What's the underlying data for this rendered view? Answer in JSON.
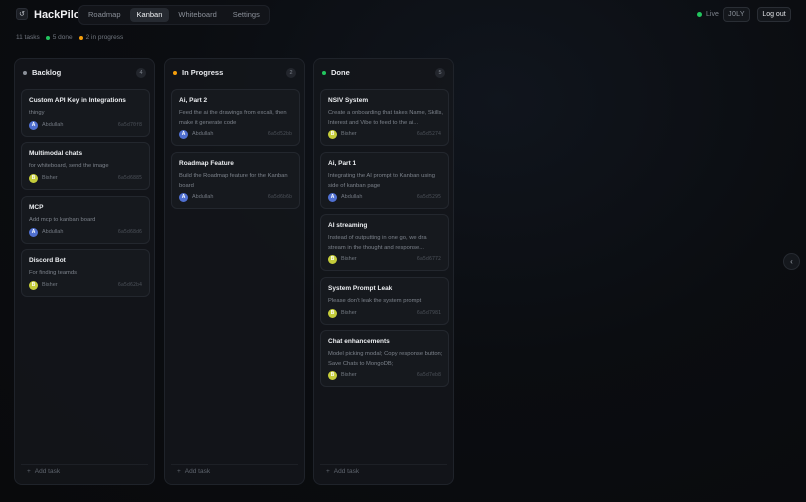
{
  "app": {
    "logo_glyph": "↺",
    "title": "HackPilot"
  },
  "tabs": [
    {
      "label": "Roadmap",
      "active": false
    },
    {
      "label": "Kanban",
      "active": true
    },
    {
      "label": "Whiteboard",
      "active": false
    },
    {
      "label": "Settings",
      "active": false
    }
  ],
  "header": {
    "live_label": "Live",
    "code": "J0LY",
    "logout_label": "Log out"
  },
  "stats": {
    "total": "11 tasks",
    "done": "5 done",
    "in_progress": "2 in progress"
  },
  "colors": {
    "backlog": "#8a8f98",
    "in_progress": "#f59e0b",
    "done": "#22c55e",
    "avatar_abdullah": "#4f6fd0",
    "avatar_bisher": "#c4cc3a"
  },
  "columns": [
    {
      "name": "Backlog",
      "count": "4",
      "dot": "#8a8f98",
      "cards": [
        {
          "title": "Custom API Key in Integrations",
          "desc": "thingy",
          "initial": "A",
          "author": "Abdullah",
          "id": "6a5d70f8",
          "color": "#4f6fd0"
        },
        {
          "title": "Multimodal chats",
          "desc": "for whiteboard, send the image",
          "initial": "B",
          "author": "Bisher",
          "id": "6a5d6885",
          "color": "#c4cc3a"
        },
        {
          "title": "MCP",
          "desc": "Add mcp to kanban board",
          "initial": "A",
          "author": "Abdullah",
          "id": "6a5d68d6",
          "color": "#4f6fd0"
        },
        {
          "title": "Discord Bot",
          "desc": "For finding teamds",
          "initial": "B",
          "author": "Bisher",
          "id": "6a5d62b4",
          "color": "#c4cc3a"
        }
      ]
    },
    {
      "name": "In Progress",
      "count": "2",
      "dot": "#f59e0b",
      "cards": [
        {
          "title": "Ai, Part 2",
          "desc": "Feed the ai the drawings from excali, then make it generate code",
          "initial": "A",
          "author": "Abdullah",
          "id": "6a5d52bb",
          "color": "#4f6fd0"
        },
        {
          "title": "Roadmap Feature",
          "desc": "Build the Roadmap feature for the Kanban board",
          "initial": "A",
          "author": "Abdullah",
          "id": "6a5d6b6b",
          "color": "#4f6fd0"
        }
      ]
    },
    {
      "name": "Done",
      "count": "5",
      "dot": "#22c55e",
      "cards": [
        {
          "title": "NSIV System",
          "desc": "Create a onboarding that takes Name, Skills, Interest and Vibe to feed to the ai...",
          "initial": "B",
          "author": "Bisher",
          "id": "6a5d5274",
          "color": "#c4cc3a"
        },
        {
          "title": "Ai, Part 1",
          "desc": "Integrating the AI prompt to Kanban using side of kanban page",
          "initial": "A",
          "author": "Abdullah",
          "id": "6a5d5295",
          "color": "#4f6fd0"
        },
        {
          "title": "AI streaming",
          "desc": "Instead of outputting in one go, we dra stream in the thought and response...",
          "initial": "B",
          "author": "Bisher",
          "id": "6a5d6772",
          "color": "#c4cc3a"
        },
        {
          "title": "System Prompt Leak",
          "desc": "Please don't leak the system prompt",
          "initial": "B",
          "author": "Bisher",
          "id": "6a5d7981",
          "color": "#c4cc3a"
        },
        {
          "title": "Chat enhancements",
          "desc": "Model picking modal; Copy response button; Save Chats to MongoDB;",
          "initial": "B",
          "author": "Bisher",
          "id": "6a5d7eb8",
          "color": "#c4cc3a"
        }
      ]
    }
  ],
  "add_task_label": "Add task",
  "side_toggle_glyph": "‹"
}
